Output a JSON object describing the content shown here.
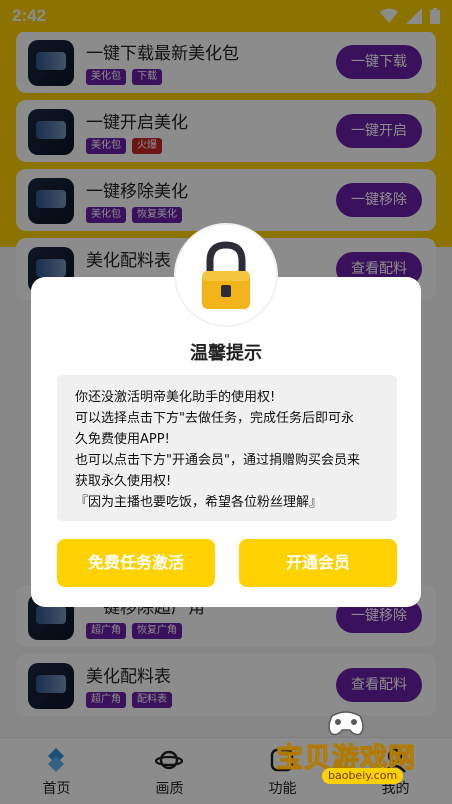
{
  "status_bar": {
    "time": "2:42"
  },
  "cards": [
    {
      "title": "一键下载最新美化包",
      "tags": [
        "美化包",
        "下载"
      ],
      "button": "一键下载"
    },
    {
      "title": "一键开启美化",
      "tags": [
        "美化包",
        "火爆"
      ],
      "button": "一键开启"
    },
    {
      "title": "一键移除美化",
      "tags": [
        "美化包",
        "恢复美化"
      ],
      "button": "一键移除"
    },
    {
      "title": "美化配料表",
      "tags": [],
      "button": "查看配料"
    },
    {
      "title": "一键移除超广角",
      "tags": [
        "超广角",
        "恢复广角"
      ],
      "button": "一键移除"
    },
    {
      "title": "美化配料表",
      "tags": [
        "超广角",
        "配料表"
      ],
      "button": "查看配料"
    }
  ],
  "dialog": {
    "title": "温馨提示",
    "message_lines": [
      "你还没激活明帝美化助手的使用权!",
      "可以选择点击下方\"去做任务，完成任务后即可永",
      "久免费使用APP!",
      "也可以点击下方\"开通会员\"，通过捐赠购买会员来",
      "获取永久使用权!",
      "『因为主播也要吃饭，希望各位粉丝理解』"
    ],
    "button_free": "免费任务激活",
    "button_vip": "开通会员"
  },
  "bottom_nav": [
    {
      "label": "首页",
      "icon": "home-icon"
    },
    {
      "label": "画质",
      "icon": "planet-icon"
    },
    {
      "label": "功能",
      "icon": "function-icon"
    },
    {
      "label": "我的",
      "icon": "profile-icon"
    }
  ],
  "watermark": {
    "name": "宝贝游戏网",
    "url": "baobeiy.com"
  },
  "colors": {
    "yellow": "#ffd100",
    "purple": "#6b1fa8",
    "hot_red": "#c62828"
  }
}
